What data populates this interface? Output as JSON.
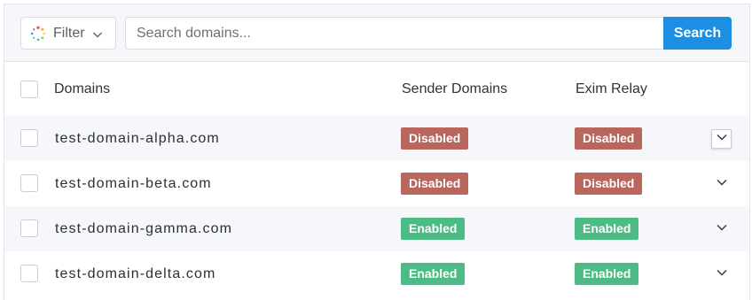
{
  "toolbar": {
    "filter_label": "Filter",
    "search_placeholder": "Search domains...",
    "search_value": "",
    "search_button_label": "Search"
  },
  "table": {
    "columns": {
      "domains": "Domains",
      "sender_domains": "Sender Domains",
      "exim_relay": "Exim Relay"
    },
    "rows": [
      {
        "domain": "test-domain-alpha.com",
        "sender_domains": "Disabled",
        "exim_relay": "Disabled"
      },
      {
        "domain": "test-domain-beta.com",
        "sender_domains": "Disabled",
        "exim_relay": "Disabled"
      },
      {
        "domain": "test-domain-gamma.com",
        "sender_domains": "Enabled",
        "exim_relay": "Enabled"
      },
      {
        "domain": "test-domain-delta.com",
        "sender_domains": "Enabled",
        "exim_relay": "Enabled"
      }
    ]
  },
  "icons": {
    "filter": "loading-spinner-icon",
    "filter_dropdown": "chevron-down-icon",
    "row_expand": "chevron-down-icon"
  },
  "colors": {
    "primary": "#1d8fe3",
    "disabled_badge": "#b9675d",
    "enabled_badge": "#4cbb85",
    "toolbar_bg": "#f5f7fa"
  }
}
